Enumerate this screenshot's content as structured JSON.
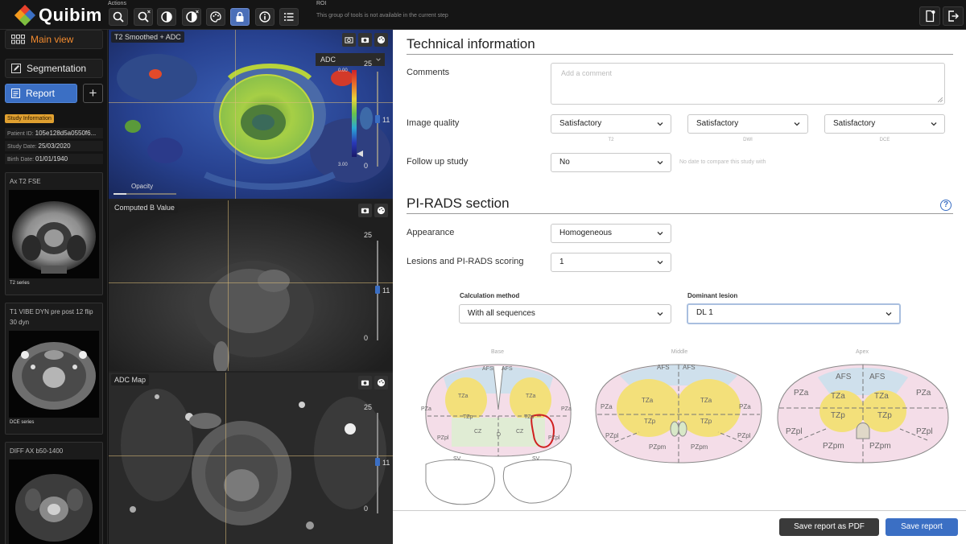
{
  "app": {
    "name": "Quibim"
  },
  "toolbar": {
    "actions_label": "Actions",
    "roi_label": "ROI",
    "roi_note": "This group of tools is not available in the current step"
  },
  "sidebar": {
    "main_view": "Main view",
    "segmentation": "Segmentation",
    "report": "Report",
    "add": "+",
    "study_badge": "Study Information",
    "patient_id_label": "Patient ID:",
    "patient_id": "105e128d5a0550f6...",
    "study_date_label": "Study Date:",
    "study_date": "25/03/2020",
    "birth_date_label": "Birth Date:",
    "birth_date": "01/01/1940",
    "series": [
      {
        "name": "Ax T2 FSE",
        "tag": "T2 series"
      },
      {
        "name": "T1 VIBE DYN pre post 12 flip 30 dyn",
        "tag": "DCE series"
      },
      {
        "name": "DIFF AX b50-1400",
        "tag": ""
      }
    ]
  },
  "viewer": {
    "panels": [
      {
        "title": "T2 Smoothed + ADC",
        "dropdown": "ADC",
        "top": "25",
        "mid": "11",
        "bottom": "0",
        "cbar_top": "0.00",
        "cbar_bottom": "3.00",
        "opacity": "Opacity"
      },
      {
        "title": "Computed B Value",
        "top": "25",
        "mid": "11",
        "bottom": "0"
      },
      {
        "title": "ADC Map",
        "top": "25",
        "mid": "11",
        "bottom": "0"
      }
    ]
  },
  "report": {
    "technical_title": "Technical information",
    "comments_label": "Comments",
    "comments_placeholder": "Add a comment",
    "image_quality_label": "Image quality",
    "quality": [
      {
        "value": "Satisfactory",
        "sub": "T2"
      },
      {
        "value": "Satisfactory",
        "sub": "DWI"
      },
      {
        "value": "Satisfactory",
        "sub": "DCE"
      }
    ],
    "follow_up_label": "Follow up study",
    "follow_up_value": "No",
    "follow_up_note": "No date to compare this study with",
    "pirads_title": "PI-RADS section",
    "help": "?",
    "appearance_label": "Appearance",
    "appearance_value": "Homogeneous",
    "lesions_label": "Lesions and PI-RADS scoring",
    "lesions_value": "1",
    "calc_label": "Calculation method",
    "calc_value": "With all sequences",
    "dominant_label": "Dominant lesion",
    "dominant_value": "DL 1",
    "diagram_labels": {
      "base": "Base",
      "middle": "Middle",
      "apex": "Apex"
    },
    "zones": {
      "afs": "AFS",
      "tza": "TZa",
      "tzp": "TZp",
      "pza": "PZa",
      "pzpl": "PZpl",
      "pzpm": "PZpm",
      "cz": "CZ",
      "d": "D",
      "svr": "SV",
      "svl": "SV"
    },
    "save_pdf": "Save report as PDF",
    "save": "Save report"
  }
}
